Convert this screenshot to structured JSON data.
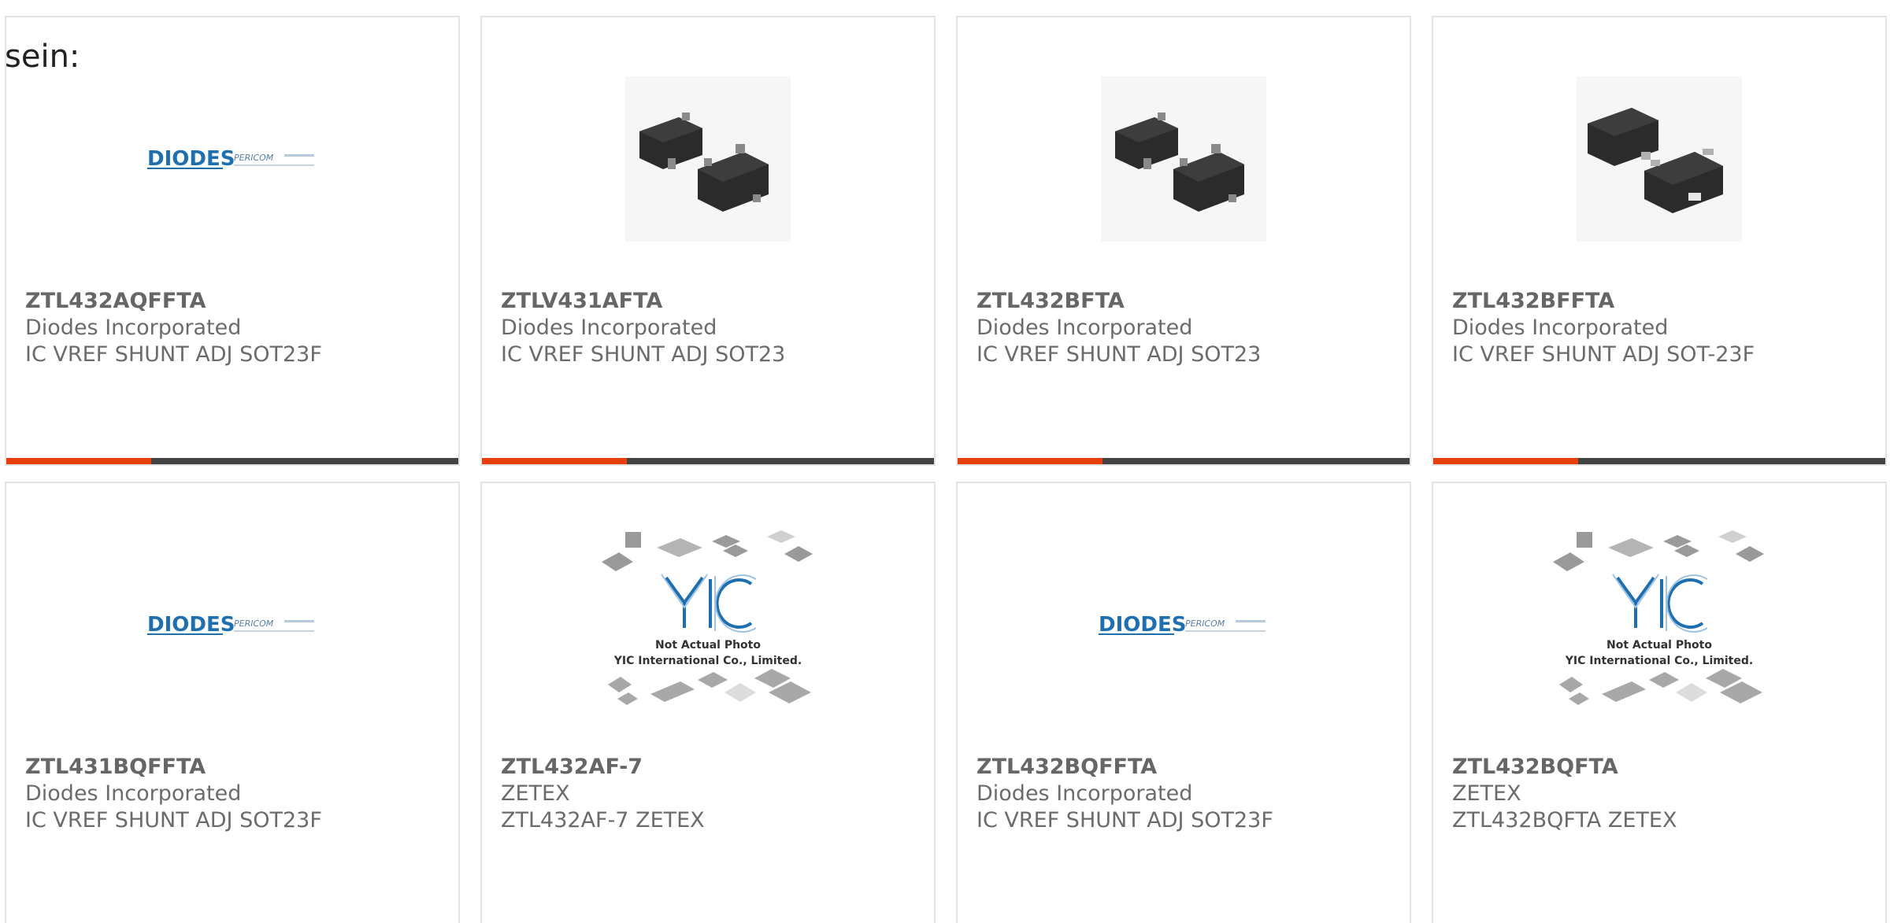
{
  "intro_text": "sein:",
  "colors": {
    "accent": "#e8400c",
    "bar": "#444444",
    "border": "#e3e3e3",
    "diodes_blue": "#1e6fb0"
  },
  "products": [
    {
      "part_number": "ZTL432AQFFTA",
      "manufacturer": "Diodes Incorporated",
      "description": "IC VREF SHUNT ADJ SOT23F",
      "image": "diodes-logo",
      "logo_text": "DIODES",
      "logo_sub": "PERICOM"
    },
    {
      "part_number": "ZTLV431AFTA",
      "manufacturer": "Diodes Incorporated",
      "description": "IC VREF SHUNT ADJ SOT23",
      "image": "sot23-package-photo"
    },
    {
      "part_number": "ZTL432BFTA",
      "manufacturer": "Diodes Incorporated",
      "description": "IC VREF SHUNT ADJ SOT23",
      "image": "sot23-package-photo"
    },
    {
      "part_number": "ZTL432BFFTA",
      "manufacturer": "Diodes Incorporated",
      "description": "IC VREF SHUNT ADJ SOT-23F",
      "image": "sot23f-package-photo"
    },
    {
      "part_number": "ZTL431BQFFTA",
      "manufacturer": "Diodes Incorporated",
      "description": "IC VREF SHUNT ADJ SOT23F",
      "image": "diodes-logo",
      "logo_text": "DIODES",
      "logo_sub": "PERICOM"
    },
    {
      "part_number": "ZTL432AF-7",
      "manufacturer": "ZETEX",
      "description": "ZTL432AF-7 ZETEX",
      "image": "yic-placeholder",
      "placeholder_line1": "Not Actual Photo",
      "placeholder_line2": "YIC International Co., Limited."
    },
    {
      "part_number": "ZTL432BQFFTA",
      "manufacturer": "Diodes Incorporated",
      "description": "IC VREF SHUNT ADJ SOT23F",
      "image": "diodes-logo",
      "logo_text": "DIODES",
      "logo_sub": "PERICOM"
    },
    {
      "part_number": "ZTL432BQFTA",
      "manufacturer": "ZETEX",
      "description": "ZTL432BQFTA ZETEX",
      "image": "yic-placeholder",
      "placeholder_line1": "Not Actual Photo",
      "placeholder_line2": "YIC International Co., Limited."
    }
  ]
}
